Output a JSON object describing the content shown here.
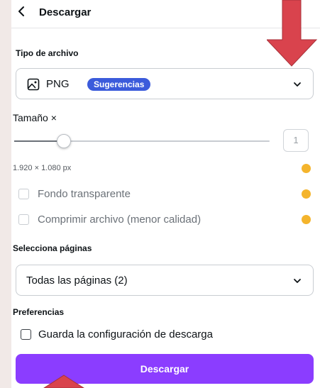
{
  "header": {
    "back_icon": "chevron-left-icon",
    "title": "Descargar"
  },
  "file_type": {
    "label": "Tipo de archivo",
    "selected": "PNG",
    "badge": "Sugerencias",
    "icon": "image-icon"
  },
  "size": {
    "label": "Tamaño ×",
    "slider_value": 1,
    "slider_fill_fraction": 0.2,
    "value_text": "1",
    "dimensions": "1.920 × 1.080 px"
  },
  "options": [
    {
      "label": "Fondo transparente",
      "checked": false,
      "premium": true
    },
    {
      "label": "Comprimir archivo (menor calidad)",
      "checked": false,
      "premium": true
    }
  ],
  "pages": {
    "label": "Selecciona páginas",
    "selected": "Todas las páginas (2)"
  },
  "preferences": {
    "label": "Preferencias",
    "save_label": "Guarda la configuración de descarga",
    "checked": false
  },
  "download_button": "Descargar",
  "colors": {
    "accent": "#8b3dff",
    "badge": "#3b5bdb",
    "crown": "#f4b42c",
    "annotation_arrow": "#d9434d"
  }
}
